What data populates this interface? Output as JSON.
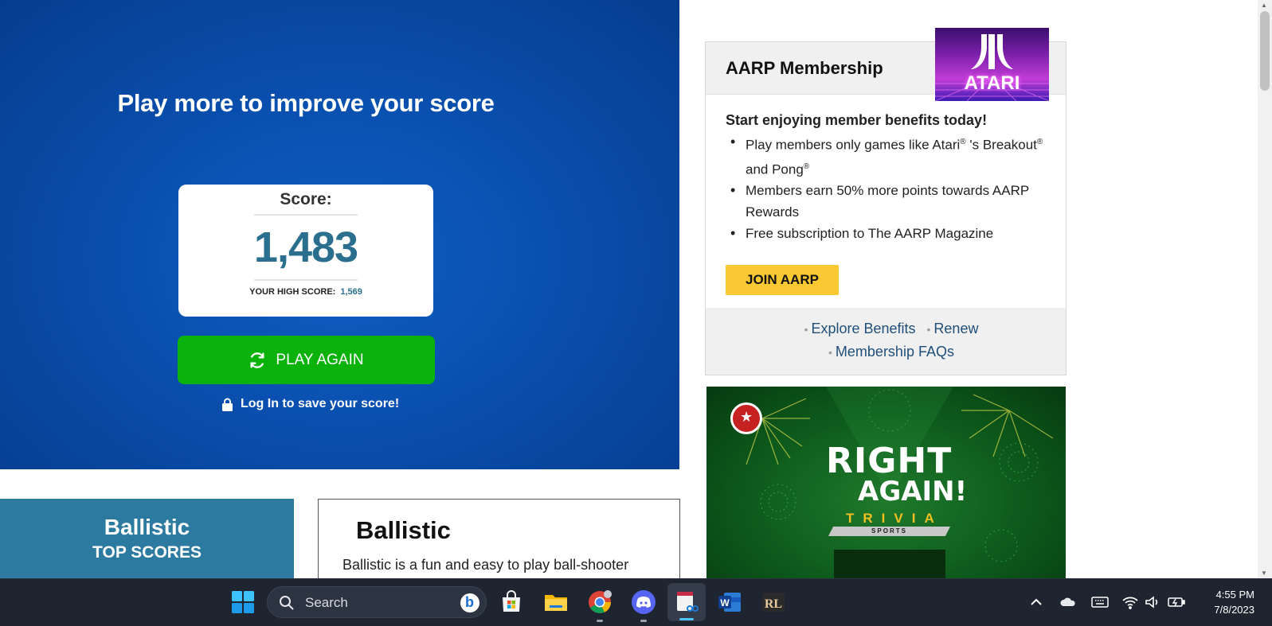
{
  "game": {
    "headline": "Play more to improve your score",
    "score_label": "Score:",
    "score_value": "1,483",
    "high_score_label": "YOUR HIGH SCORE:",
    "high_score_value": "1,569",
    "play_again_label": "PLAY AGAIN",
    "login_save_label": "Log In to save your score!"
  },
  "top_scores": {
    "title": "Ballistic",
    "subtitle": "TOP SCORES"
  },
  "description": {
    "title": "Ballistic",
    "text": "Ballistic is a fun and easy to play ball-shooter"
  },
  "aarp": {
    "title": "AARP Membership",
    "logo_text": "ATARI",
    "lead": "Start enjoying member benefits today!",
    "benefits": [
      {
        "prefix": "Play members only games like Atari",
        "mid": " 's Breakout",
        "suffix": " and Pong",
        "mark": "®"
      },
      {
        "text": "Members earn 50% more points towards AARP Rewards"
      },
      {
        "text": "Free subscription to The AARP Magazine"
      }
    ],
    "join_label": "JOIN AARP",
    "links": [
      "Explore Benefits",
      "Renew",
      "Membership FAQs"
    ]
  },
  "ad": {
    "line1": "RIGHT",
    "line2": "AGAIN!",
    "line3": "TRIVIA",
    "line4": "SPORTS"
  },
  "taskbar": {
    "search_placeholder": "Search",
    "time": "4:55 PM",
    "date": "7/8/2023",
    "apps": [
      "microsoft-store-icon",
      "file-explorer-icon",
      "chrome-icon",
      "discord-icon",
      "snipping-tool-icon",
      "word-icon",
      "rl-app-icon"
    ]
  },
  "colors": {
    "game_bg": "#0a4fae",
    "score_text": "#2a6f8e",
    "play_again": "#0bb20b",
    "top_scores_bg": "#2d7aa0",
    "join_button": "#fac832",
    "link": "#1f4f7a",
    "taskbar_bg": "#1f2530"
  }
}
